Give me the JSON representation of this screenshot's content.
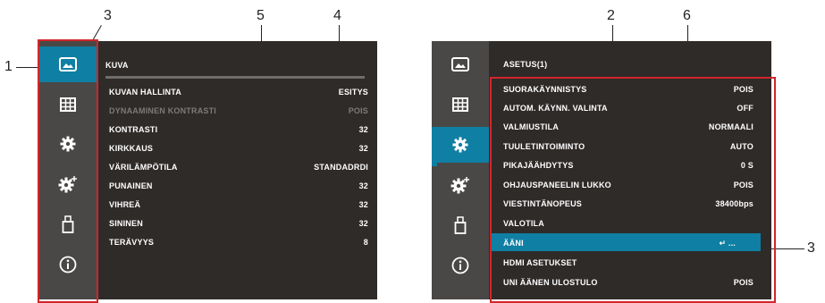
{
  "callouts": {
    "c1": "1",
    "c3a": "3",
    "c5": "5",
    "c4": "4",
    "c2": "2",
    "c6": "6",
    "c3b": "3"
  },
  "left_screen": {
    "title": "KUVA",
    "rows": [
      {
        "label": "KUVAN HALLINTA",
        "value": "ESITYS",
        "enabled": true
      },
      {
        "label": "DYNAAMINEN KONTRASTI",
        "value": "POIS",
        "enabled": false
      },
      {
        "label": "KONTRASTI",
        "value": "32",
        "enabled": true
      },
      {
        "label": "KIRKKAUS",
        "value": "32",
        "enabled": true
      },
      {
        "label": "VÄRILÄMPÖTILA",
        "value": "STANDADRDI",
        "enabled": true
      },
      {
        "label": "PUNAINEN",
        "value": "32",
        "enabled": true
      },
      {
        "label": "VIHREÄ",
        "value": "32",
        "enabled": true
      },
      {
        "label": "SININEN",
        "value": "32",
        "enabled": true
      },
      {
        "label": "TERÄVYYS",
        "value": "8",
        "enabled": true
      }
    ]
  },
  "right_screen": {
    "title": "ASETUS(1)",
    "rows": [
      {
        "label": "SUORAKÄYNNISTYS",
        "value": "POIS"
      },
      {
        "label": "AUTOM. KÄYNN. VALINTA",
        "value": "OFF"
      },
      {
        "label": "VALMIUSTILA",
        "value": "NORMAALI"
      },
      {
        "label": "TUULETINTOIMINTO",
        "value": "AUTO"
      },
      {
        "label": "PIKAJÄÄHDYTYS",
        "value": "0 S"
      },
      {
        "label": "OHJAUSPANEELIN LUKKO",
        "value": "POIS"
      },
      {
        "label": "VIESTINTÄNOPEUS",
        "value": "38400bps"
      },
      {
        "label": "VALOTILA",
        "value": ""
      },
      {
        "label": "ÄÄNI",
        "value": "↵ ...",
        "selected": true
      },
      {
        "label": "HDMI ASETUKSET",
        "value": ""
      },
      {
        "label": "UNI ÄÄNEN ULOSTULO",
        "value": "POIS"
      }
    ]
  },
  "sidebar_icons": [
    "picture-icon",
    "grid-icon",
    "gear-icon",
    "gear-plus-icon",
    "usb-icon",
    "info-icon"
  ],
  "colors": {
    "panel_bg": "#2f2b29",
    "sidebar_bg": "#4a4846",
    "accent": "#0f7fa3",
    "callout_box": "#d1262b"
  }
}
